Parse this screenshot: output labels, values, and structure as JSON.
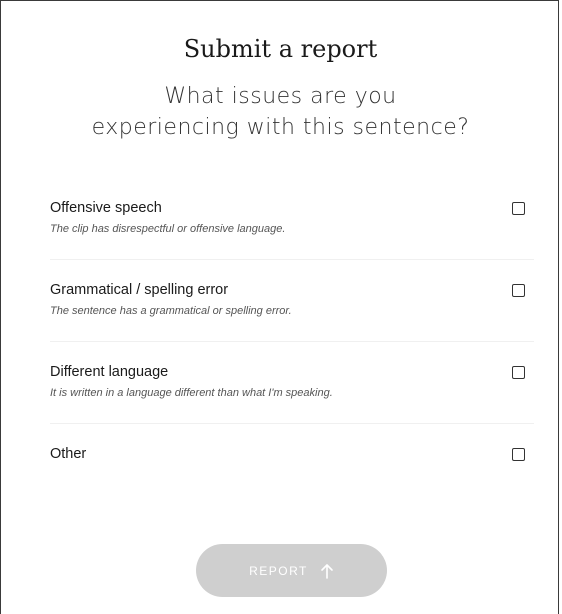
{
  "dialog": {
    "title": "Submit a report",
    "subtitle": "What issues are you experiencing with this sentence?"
  },
  "options": [
    {
      "label": "Offensive speech",
      "description": "The clip has disrespectful or offensive language.",
      "checked": false
    },
    {
      "label": "Grammatical / spelling error",
      "description": "The sentence has a grammatical or spelling error.",
      "checked": false
    },
    {
      "label": "Different language",
      "description": "It is written in a language different than what I'm speaking.",
      "checked": false
    },
    {
      "label": "Other",
      "description": "",
      "checked": false
    }
  ],
  "submit": {
    "label": "REPORT",
    "icon": "arrow-up-icon",
    "enabled": false
  },
  "colors": {
    "button_disabled": "#cfcfcf",
    "button_text": "#ffffff",
    "border": "#3a3a3a"
  }
}
